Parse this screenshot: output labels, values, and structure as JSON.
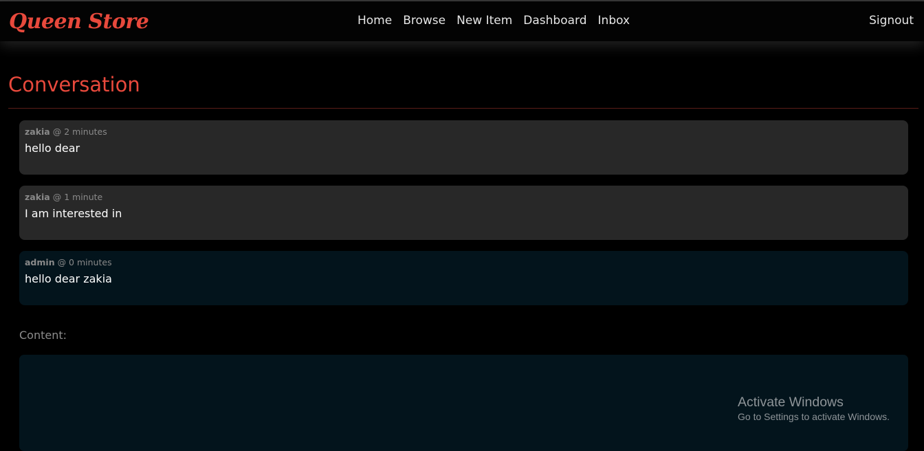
{
  "brand": "Queen Store",
  "nav": {
    "links": [
      "Home",
      "Browse",
      "New Item",
      "Dashboard",
      "Inbox"
    ],
    "signout": "Signout"
  },
  "page": {
    "title": "Conversation"
  },
  "messages": [
    {
      "user": "zakia",
      "time": "@ 2 minutes",
      "text": "hello dear",
      "mine": false
    },
    {
      "user": "zakia",
      "time": "@ 1 minute",
      "text": "I am interested in",
      "mine": false
    },
    {
      "user": "admin",
      "time": "@ 0 minutes",
      "text": "hello dear zakia",
      "mine": true
    }
  ],
  "form": {
    "content_label": "Content:",
    "content_value": ""
  },
  "watermark": {
    "title": "Activate Windows",
    "subtitle": "Go to Settings to activate Windows."
  },
  "colors": {
    "accent": "#e8493c",
    "message_other_bg": "#282828",
    "message_self_bg": "#03141c"
  }
}
